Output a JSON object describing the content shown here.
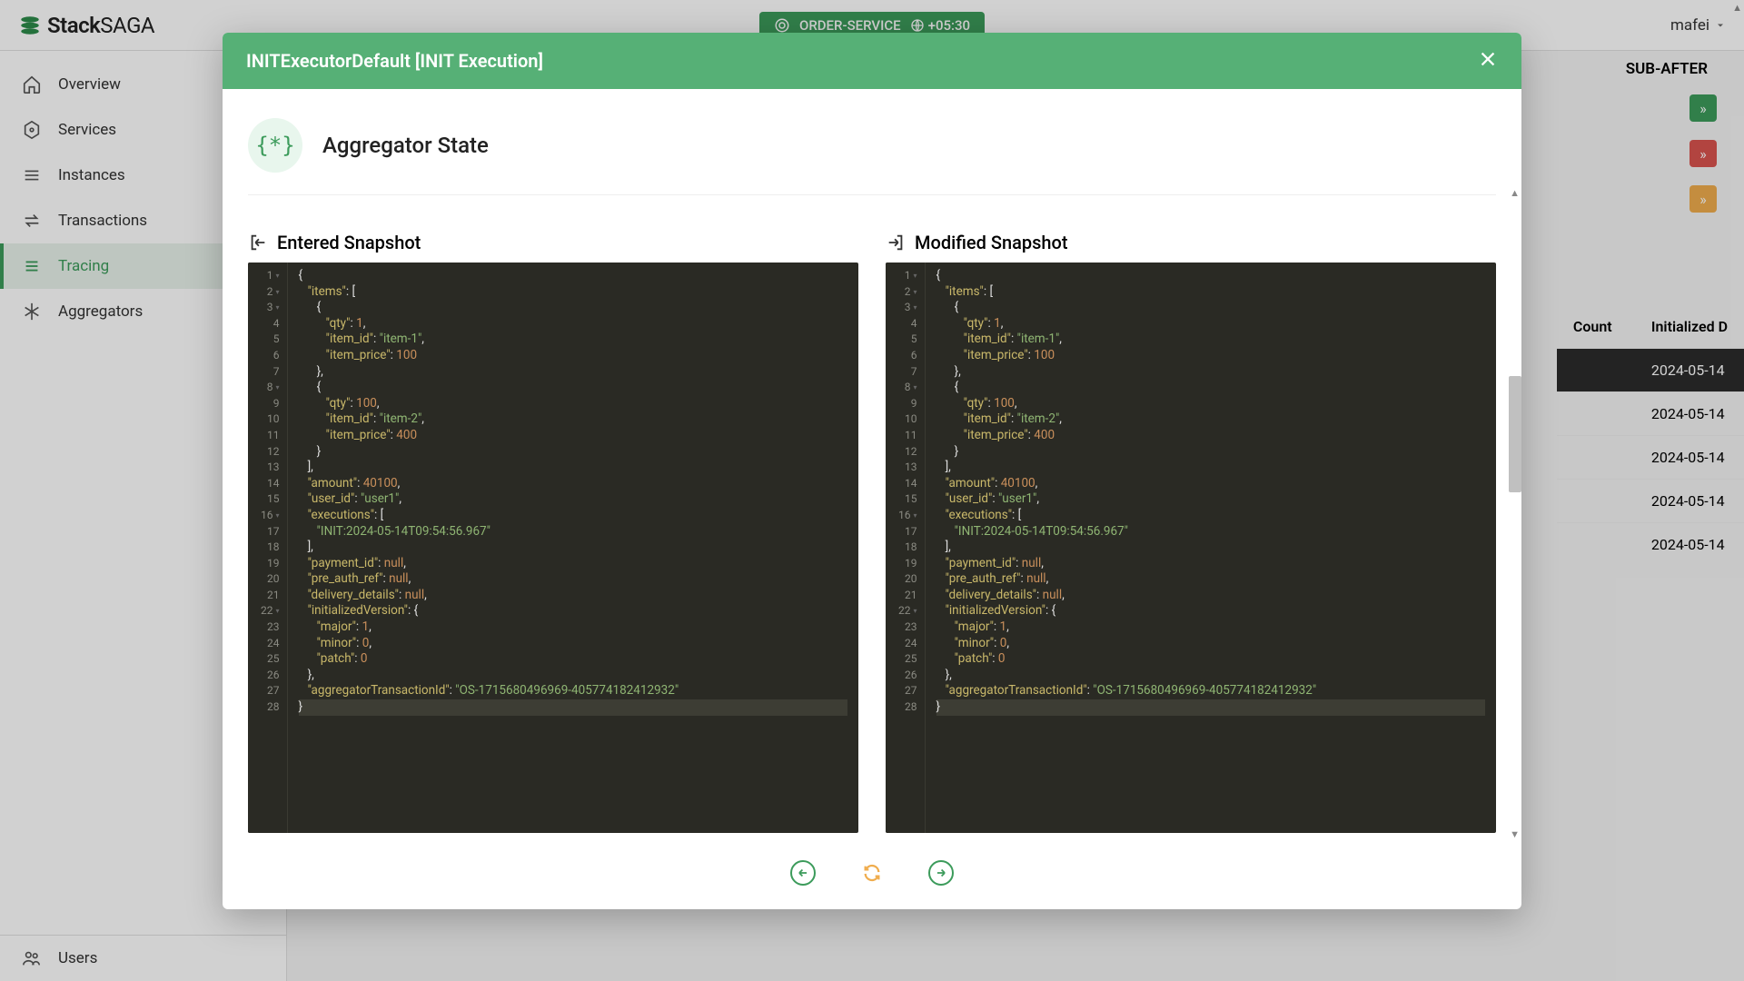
{
  "brand": {
    "first": "Stack",
    "second": "SAGA"
  },
  "service_badge": {
    "name": "ORDER-SERVICE",
    "tz": "+05:30"
  },
  "user": {
    "name": "mafei"
  },
  "sidebar": {
    "items": [
      {
        "label": "Overview"
      },
      {
        "label": "Services"
      },
      {
        "label": "Instances"
      },
      {
        "label": "Transactions"
      },
      {
        "label": "Tracing"
      },
      {
        "label": "Aggregators"
      }
    ],
    "bottom": {
      "label": "Users"
    }
  },
  "background": {
    "sub_after": "SUB-AFTER",
    "table": {
      "headers": [
        "Count",
        "Initialized D"
      ],
      "rows": [
        [
          "",
          "2024-05-14"
        ],
        [
          "",
          "2024-05-14"
        ],
        [
          "",
          "2024-05-14"
        ],
        [
          "",
          "2024-05-14"
        ],
        [
          "",
          "2024-05-14"
        ]
      ],
      "highlight_index": 0
    }
  },
  "modal": {
    "title": "INITExecutorDefault [INIT Execution]",
    "section_icon": "{*}",
    "section_title": "Aggregator State",
    "entered_label": "Entered Snapshot",
    "modified_label": "Modified Snapshot",
    "snapshot_lines": 28,
    "snapshot_json": {
      "items": [
        {
          "qty": 1,
          "item_id": "item-1",
          "item_price": 100
        },
        {
          "qty": 100,
          "item_id": "item-2",
          "item_price": 400
        }
      ],
      "amount": 40100,
      "user_id": "user1",
      "executions": [
        "INIT:2024-05-14T09:54:56.967"
      ],
      "payment_id": null,
      "pre_auth_ref": null,
      "delivery_details": null,
      "initializedVersion": {
        "major": 1,
        "minor": 0,
        "patch": 0
      },
      "aggregatorTransactionId": "OS-1715680496969-405774182412932"
    }
  }
}
